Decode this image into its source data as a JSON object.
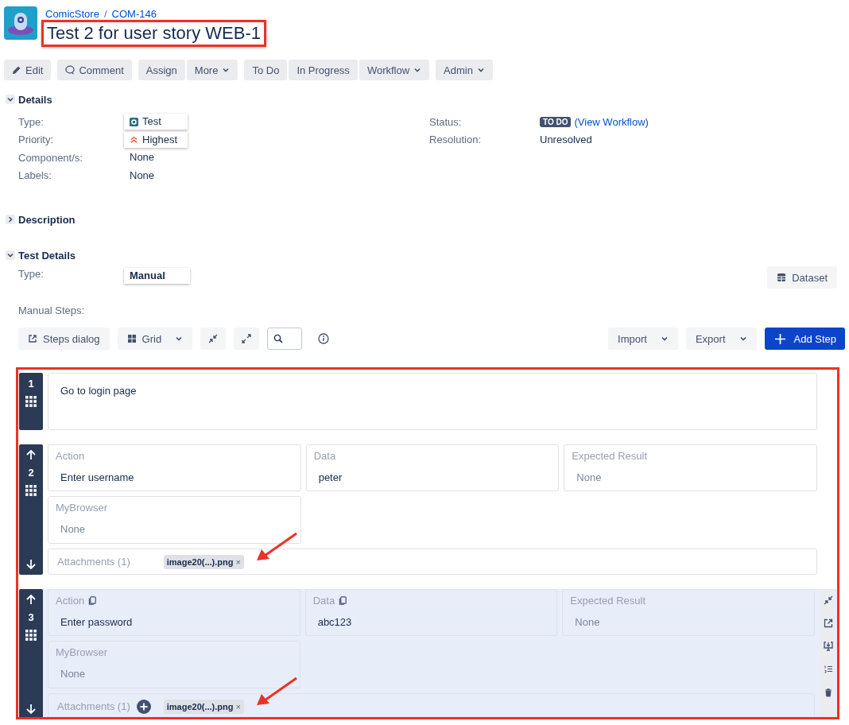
{
  "header": {
    "breadcrumb": [
      "ComicStore",
      "COM-146"
    ],
    "separator": "/",
    "title": "Test 2 for user story WEB-1",
    "highlighted": true
  },
  "toolbar": [
    [
      {
        "label": "Edit",
        "kind": "edit"
      }
    ],
    [
      {
        "label": "Comment",
        "kind": "comment"
      }
    ],
    [
      {
        "label": "Assign",
        "kind": "plain"
      },
      {
        "label": "More",
        "kind": "dropdown"
      }
    ],
    [
      {
        "label": "To Do",
        "kind": "plain"
      },
      {
        "label": "In Progress",
        "kind": "plain"
      },
      {
        "label": "Workflow",
        "kind": "dropdown"
      }
    ],
    [
      {
        "label": "Admin",
        "kind": "dropdown"
      }
    ]
  ],
  "details": {
    "title": "Details",
    "expanded": true,
    "left": [
      {
        "label": "Type:",
        "value": "Test",
        "kind": "type",
        "highlighted": true
      },
      {
        "label": "Priority:",
        "value": "Highest",
        "kind": "priority",
        "highlighted": true
      },
      {
        "label": "Component/s:",
        "value": "None",
        "kind": "plain",
        "highlighted": false
      },
      {
        "label": "Labels:",
        "value": "None",
        "kind": "plain",
        "highlighted": false
      }
    ],
    "right": [
      {
        "label": "Status:",
        "value": "TO DO",
        "link": "(View Workflow)",
        "kind": "status"
      },
      {
        "label": "Resolution:",
        "value": "Unresolved",
        "kind": "plain"
      }
    ]
  },
  "description": {
    "title": "Description",
    "expanded": false
  },
  "test_details": {
    "title": "Test Details",
    "expanded": true,
    "type_label": "Type:",
    "type_value": "Manual",
    "highlighted": true,
    "dataset_button": "Dataset",
    "manual_steps_label": "Manual Steps:"
  },
  "steps_toolbar": {
    "steps_dialog": "Steps dialog",
    "grid": "Grid",
    "import": "Import",
    "export": "Export",
    "add_step": "Add Step"
  },
  "steps": {
    "highlighted": true,
    "items": [
      {
        "number": "1",
        "kind": "simple",
        "selected": false,
        "text": "Go to login page"
      },
      {
        "number": "2",
        "kind": "full",
        "selected": false,
        "fields": [
          {
            "label": "Action",
            "value": "Enter username",
            "empty": false
          },
          {
            "label": "Data",
            "value": "peter",
            "empty": false
          },
          {
            "label": "Expected Result",
            "value": "None",
            "empty": true
          }
        ],
        "custom": {
          "label": "MyBrowser",
          "value": "None",
          "empty": true
        },
        "attachments": {
          "label": "Attachments (1)",
          "file": "image20(...).png",
          "remove": "×",
          "annotated": true
        }
      },
      {
        "number": "3",
        "kind": "full",
        "selected": true,
        "fields": [
          {
            "label": "Action",
            "value": "Enter password",
            "empty": false
          },
          {
            "label": "Data",
            "value": "abc123",
            "empty": false
          },
          {
            "label": "Expected Result",
            "value": "None",
            "empty": true
          }
        ],
        "custom": {
          "label": "MyBrowser",
          "value": "None",
          "empty": true
        },
        "attachments": {
          "label": "Attachments (1)",
          "file": "image20(...).png",
          "remove": "×",
          "annotated": true
        }
      }
    ]
  }
}
